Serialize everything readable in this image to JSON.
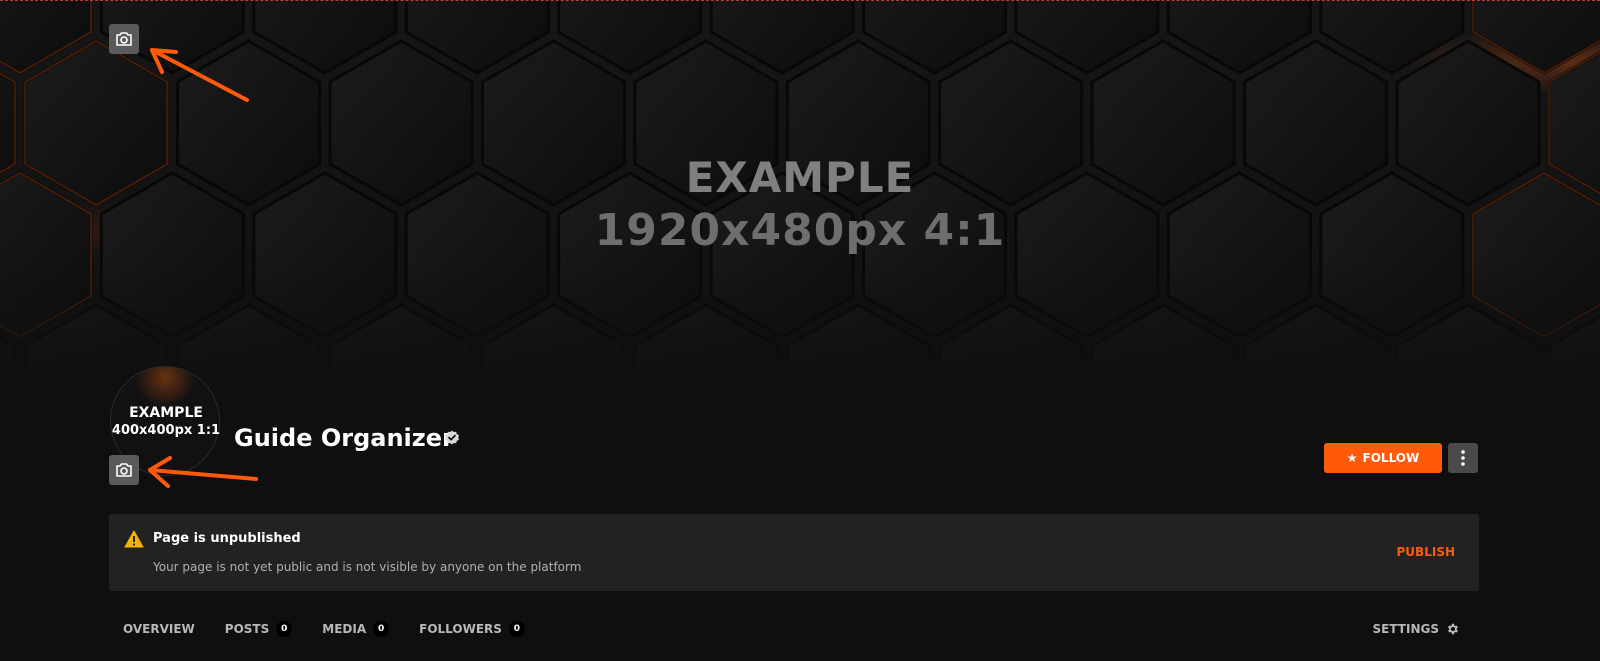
{
  "banner": {
    "line1": "EXAMPLE",
    "line2": "1920x480px 4:1",
    "camera_icon": "camera-icon"
  },
  "avatar": {
    "line1": "EXAMPLE",
    "line2": "400x400px 1:1",
    "camera_icon": "camera-icon"
  },
  "profile": {
    "name": "Guide Organizer",
    "verified_icon": "verified-badge-icon"
  },
  "actions": {
    "follow_label": "FOLLOW",
    "follow_icon": "star-icon",
    "more_icon": "more-vertical-icon"
  },
  "notice": {
    "icon": "warning-icon",
    "title": "Page is unpublished",
    "description": "Your page is not yet public and is not visible by anyone on the platform",
    "publish_label": "PUBLISH"
  },
  "tabs": [
    {
      "label": "OVERVIEW",
      "count": null
    },
    {
      "label": "POSTS",
      "count": "0"
    },
    {
      "label": "MEDIA",
      "count": "0"
    },
    {
      "label": "FOLLOWERS",
      "count": "0"
    }
  ],
  "settings": {
    "label": "SETTINGS",
    "icon": "gear-icon"
  },
  "colors": {
    "accent": "#ff5a0a",
    "background": "#0f0f10",
    "panel": "#222223",
    "annotation_arrow": "#ff5a0a"
  }
}
